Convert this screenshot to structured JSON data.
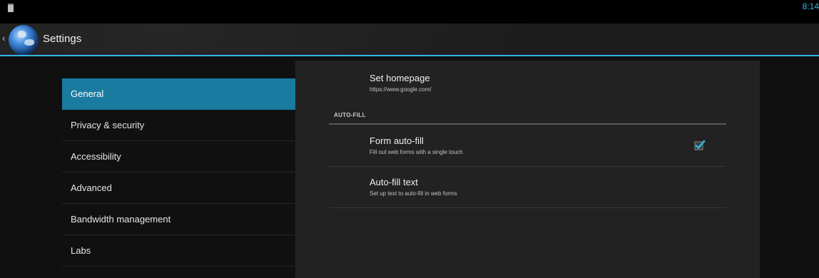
{
  "status_bar": {
    "time": "8:14"
  },
  "action_bar": {
    "title": "Settings"
  },
  "nav": {
    "items": [
      {
        "label": "General",
        "active": true
      },
      {
        "label": "Privacy & security",
        "active": false
      },
      {
        "label": "Accessibility",
        "active": false
      },
      {
        "label": "Advanced",
        "active": false
      },
      {
        "label": "Bandwidth management",
        "active": false
      },
      {
        "label": "Labs",
        "active": false
      }
    ]
  },
  "panel": {
    "homepage": {
      "title": "Set homepage",
      "summary": "https://www.google.com/"
    },
    "category": "AUTO-FILL",
    "form_autofill": {
      "title": "Form auto-fill",
      "summary": "Fill out web forms with a single touch",
      "checked": true
    },
    "autofill_text": {
      "title": "Auto-fill text",
      "summary": "Set up text to auto-fill in web forms"
    }
  },
  "colors": {
    "accent": "#33b5e5",
    "selected": "#197ba0"
  }
}
